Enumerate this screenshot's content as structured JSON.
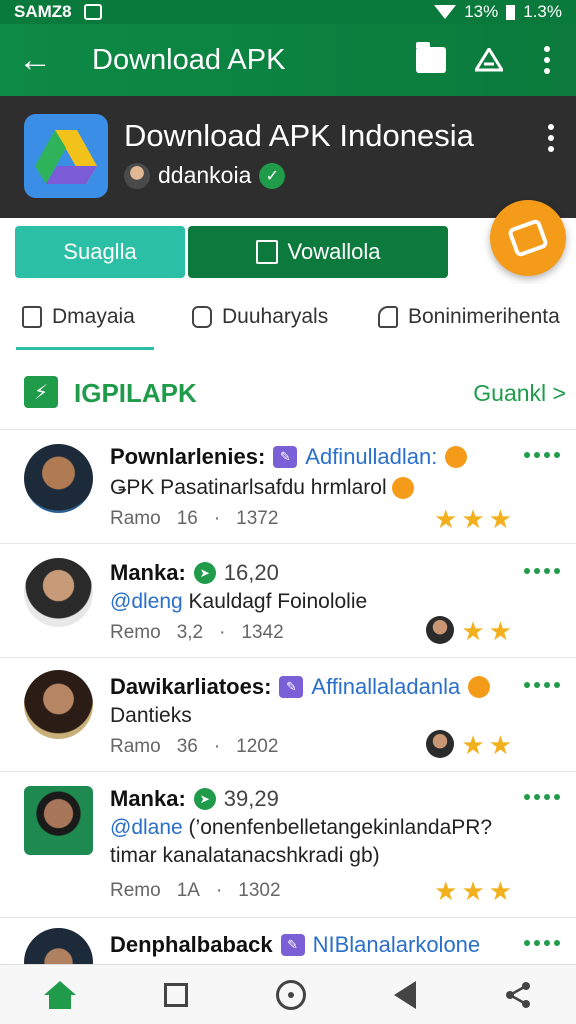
{
  "status_bar": {
    "carrier": "SAMZ8",
    "battery_pct": "13%",
    "data": "1.3%"
  },
  "app_bar": {
    "title": "Download APK"
  },
  "header": {
    "title": "Download APK Indonesia",
    "author": "ddankoia"
  },
  "actions": {
    "primary": "Suaglla",
    "secondary": "Vowallola"
  },
  "tabs": [
    {
      "label": "Dmayaia"
    },
    {
      "label": "Duuharyals"
    },
    {
      "label": "Boninimerihenta"
    }
  ],
  "section": {
    "title": "IGPILAPK",
    "more": "Guankl >"
  },
  "feed": [
    {
      "name": "Pownlarlenies:",
      "tag": "Adfinulladlan:",
      "text": "ǤPK Pasatinarlsafdu hrmlarol",
      "meta_label": "Ramo",
      "count": "16",
      "date": "1372",
      "stars": 3
    },
    {
      "name": "Manka:",
      "num": "16,20",
      "handle": "@dleng",
      "text": "Kauldagf Foinololie",
      "meta_label": "Remo",
      "count": "3,2",
      "date": "1342",
      "stars": 2
    },
    {
      "name": "Dawikarliatoes:",
      "tag": "Affinallaladanla",
      "text": "Dantieks",
      "meta_label": "Ramo",
      "count": "36",
      "date": "1202",
      "stars": 2
    },
    {
      "name": "Manka:",
      "num": "39,29",
      "handle": "@dlane",
      "text": "(’onenfenbelletangekinlandaPR?",
      "text2": "timar kanalatanacshkradi gb)",
      "meta_label": "Remo",
      "count": "1A",
      "date": "1302",
      "stars": 3
    },
    {
      "name": "Denphalbaback",
      "tag": "NIBlanalarkolone"
    }
  ],
  "colors": {
    "primary_green": "#0b7a3c",
    "teal": "#2bbfa6",
    "accent_orange": "#f59b1a",
    "header_dark": "#2e2e2e",
    "link_blue": "#2a6fc9"
  }
}
